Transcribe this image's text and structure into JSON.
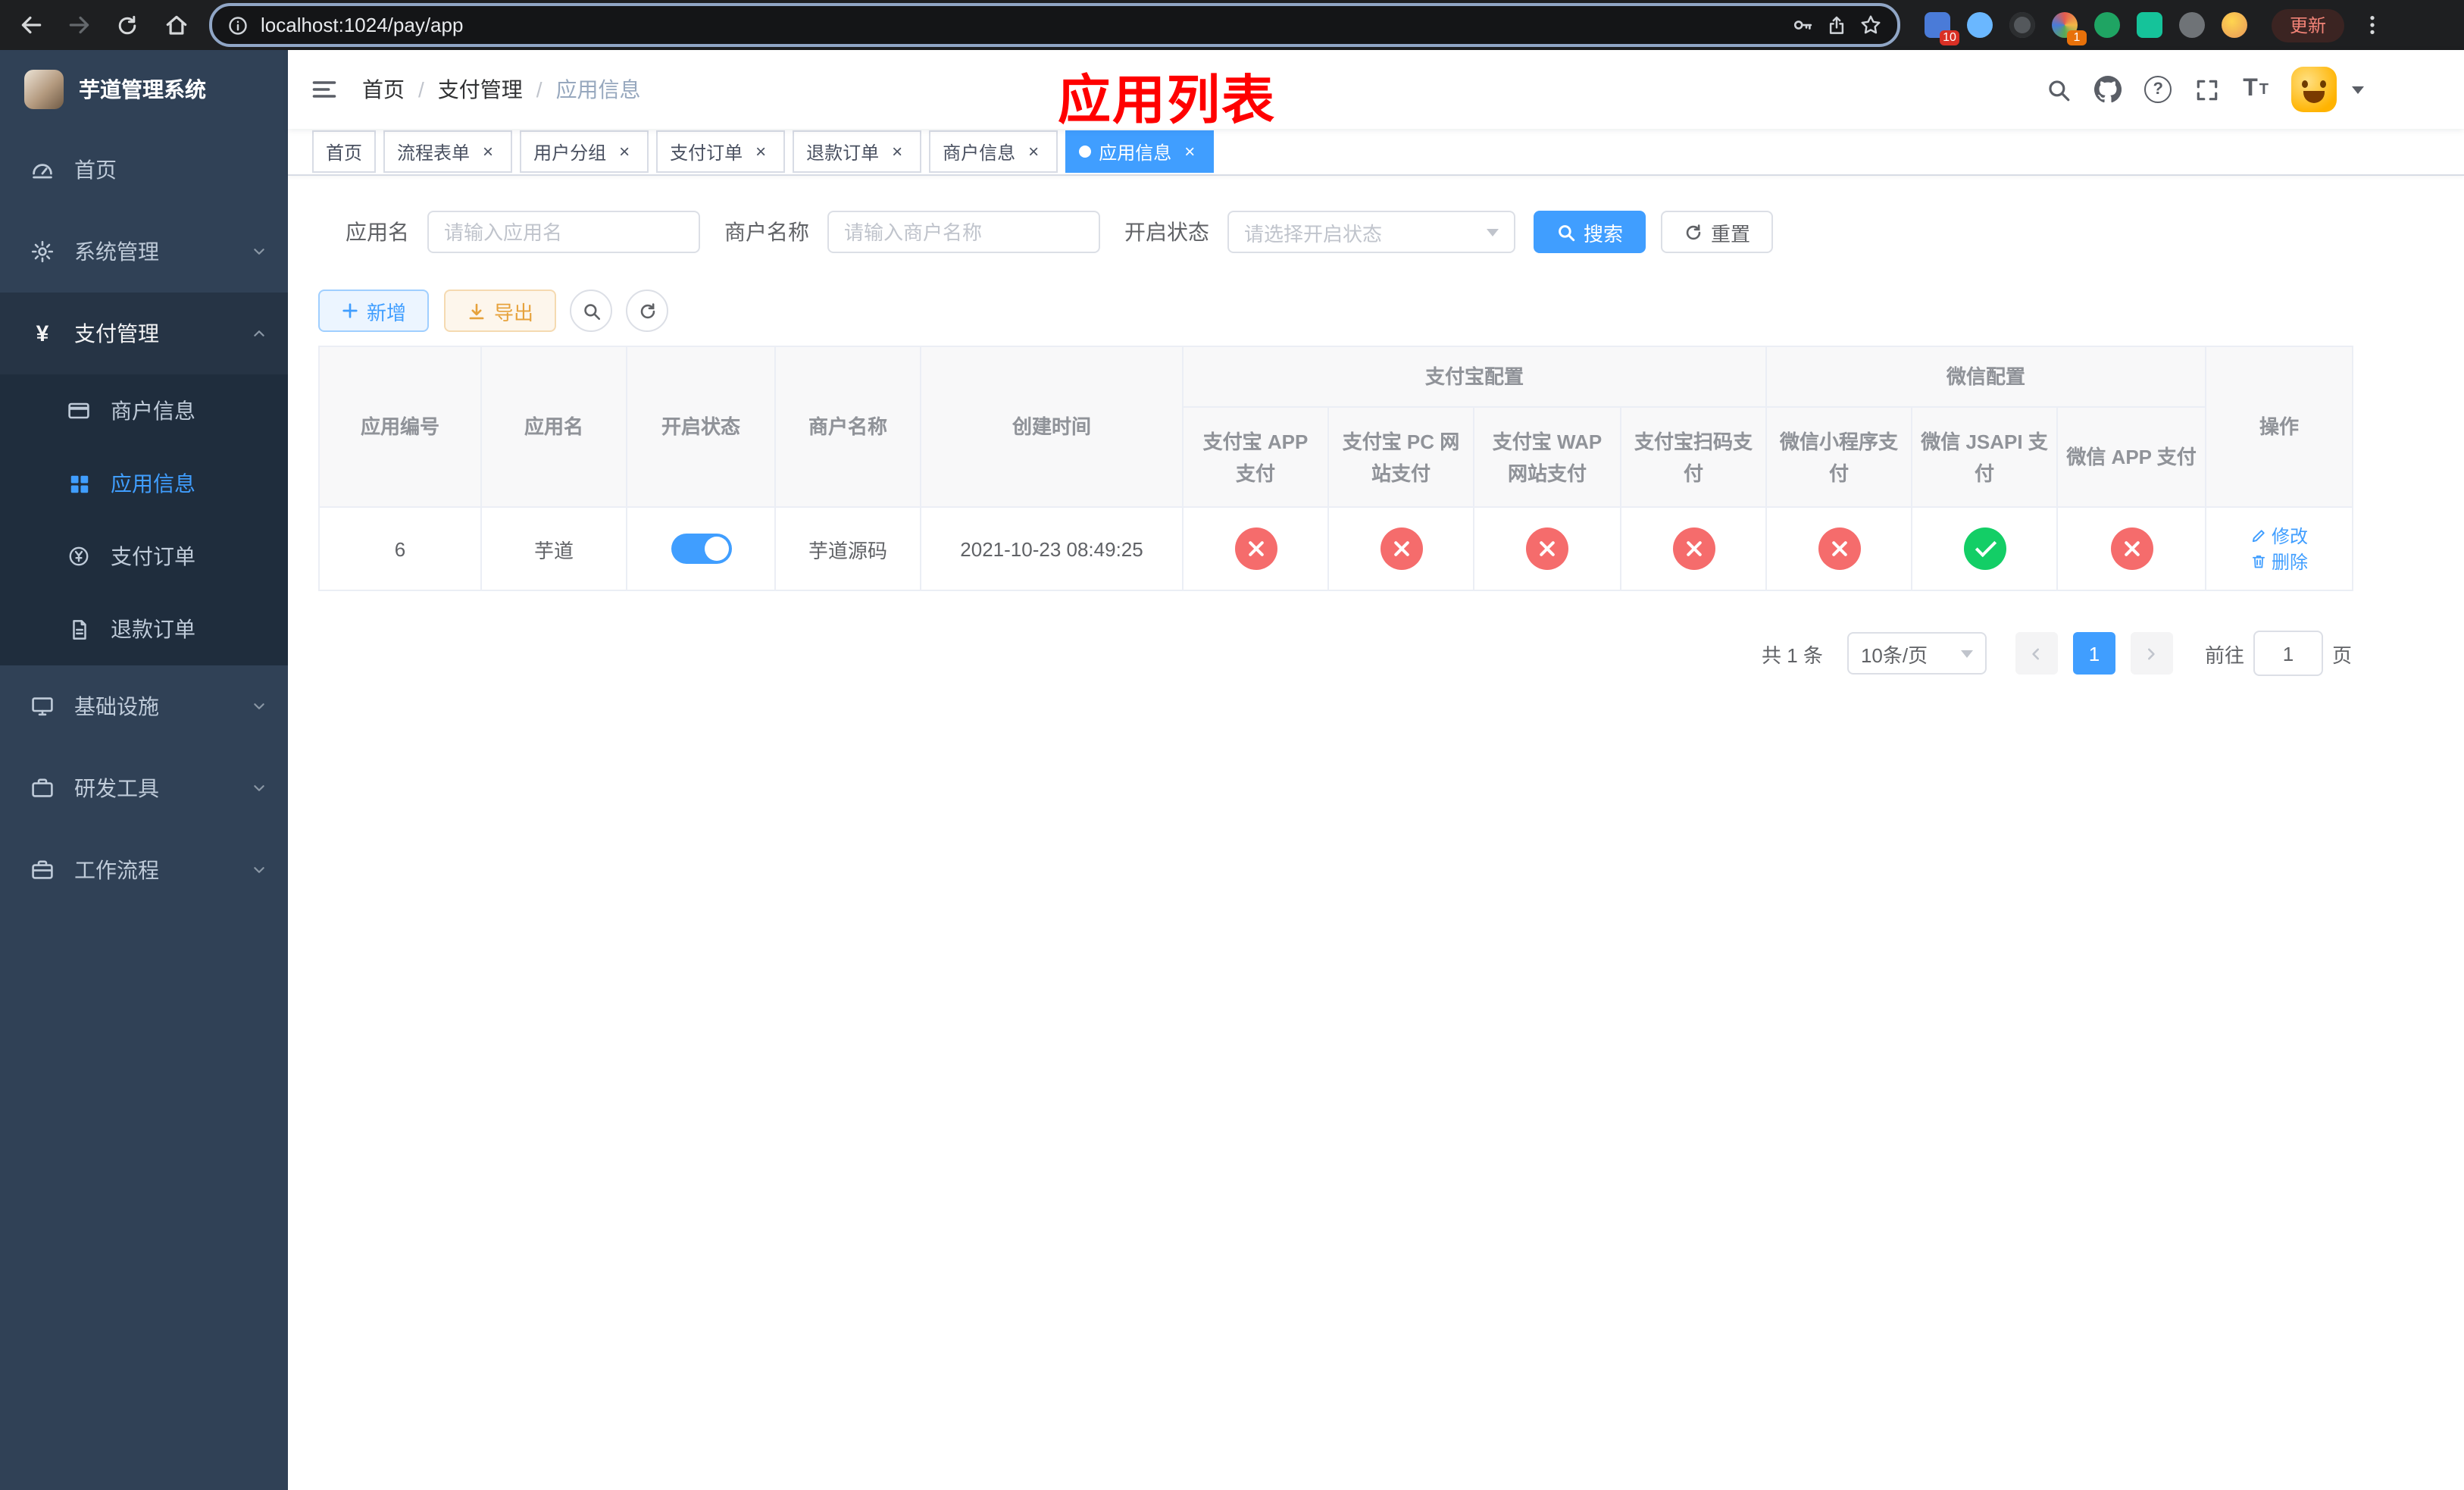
{
  "colors": {
    "primary": "#409eff",
    "success": "#13ce66",
    "danger": "#f56c6c",
    "warning": "#e6a23c",
    "annotation": "#ff0000",
    "sidebar_bg": "#304156",
    "sidebar_sub_bg": "#1f2d3d"
  },
  "browser": {
    "url": "localhost:1024/pay/app",
    "update_label": "更新",
    "badges": [
      "10",
      "1"
    ]
  },
  "sidebar": {
    "title": "芋道管理系统",
    "menu": [
      {
        "label": "首页"
      },
      {
        "label": "系统管理"
      },
      {
        "label": "支付管理"
      },
      {
        "label": "基础设施"
      },
      {
        "label": "研发工具"
      },
      {
        "label": "工作流程"
      }
    ],
    "submenu": [
      {
        "label": "商户信息"
      },
      {
        "label": "应用信息"
      },
      {
        "label": "支付订单"
      },
      {
        "label": "退款订单"
      }
    ]
  },
  "navbar": {
    "breadcrumb": [
      {
        "label": "首页"
      },
      {
        "label": "支付管理"
      },
      {
        "label": "应用信息"
      }
    ],
    "annotation": "应用列表"
  },
  "tags": [
    {
      "label": "首页"
    },
    {
      "label": "流程表单"
    },
    {
      "label": "用户分组"
    },
    {
      "label": "支付订单"
    },
    {
      "label": "退款订单"
    },
    {
      "label": "商户信息"
    },
    {
      "label": "应用信息"
    }
  ],
  "filters": {
    "app_name": {
      "label": "应用名",
      "placeholder": "请输入应用名",
      "value": ""
    },
    "merchant_name": {
      "label": "商户名称",
      "placeholder": "请输入商户名称",
      "value": ""
    },
    "status": {
      "label": "开启状态",
      "placeholder": "请选择开启状态"
    },
    "search": "搜索",
    "reset": "重置"
  },
  "toolbar": {
    "add": "新增",
    "export": "导出"
  },
  "table": {
    "groups": {
      "alipay": "支付宝配置",
      "wechat": "微信配置"
    },
    "columns": {
      "id": "应用编号",
      "name": "应用名",
      "status": "开启状态",
      "merchant": "商户名称",
      "created": "创建时间",
      "alipay_app": "支付宝 APP 支付",
      "alipay_pc": "支付宝 PC 网站支付",
      "alipay_wap": "支付宝 WAP 网站支付",
      "alipay_qr": "支付宝扫码支付",
      "wx_mini": "微信小程序支付",
      "wx_jsapi": "微信 JSAPI 支付",
      "wx_app": "微信 APP 支付",
      "actions": "操作"
    },
    "rows": [
      {
        "id": "6",
        "name": "芋道",
        "status": "on",
        "merchant": "芋道源码",
        "created": "2021-10-23 08:49:25",
        "configs": {
          "alipay_app": "disabled",
          "alipay_pc": "disabled",
          "alipay_wap": "disabled",
          "alipay_qr": "disabled",
          "wx_mini": "disabled",
          "wx_jsapi": "enabled",
          "wx_app": "disabled"
        },
        "actions": {
          "edit": "修改",
          "delete": "删除"
        }
      }
    ]
  },
  "pagination": {
    "total": "共 1 条",
    "page_size": "10条/页",
    "page": "1",
    "goto_label": "前往",
    "goto_value": "1",
    "goto_suffix": "页"
  }
}
